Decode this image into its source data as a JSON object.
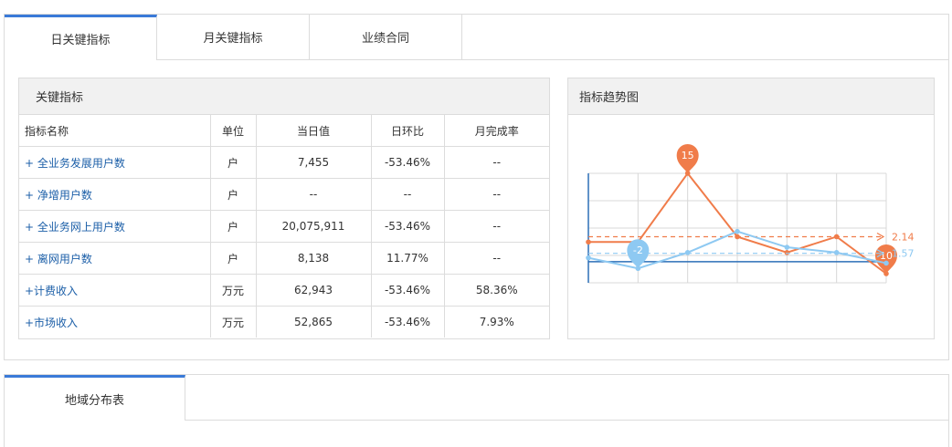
{
  "tabs": [
    {
      "label": "日关键指标",
      "active": true
    },
    {
      "label": "月关键指标",
      "active": false
    },
    {
      "label": "业绩合同",
      "active": false
    }
  ],
  "kpi": {
    "title": "关键指标",
    "headers": [
      "指标名称",
      "单位",
      "当日值",
      "日环比",
      "月完成率"
    ],
    "rows": [
      {
        "name": "+ 全业务发展用户数",
        "unit": "户",
        "value": "7,455",
        "dod": "-53.46%",
        "mtd": "--"
      },
      {
        "name": "+ 净增用户数",
        "unit": "户",
        "value": "--",
        "dod": "--",
        "mtd": "--"
      },
      {
        "name": "+ 全业务网上用户数",
        "unit": "户",
        "value": "20,075,911",
        "dod": "-53.46%",
        "mtd": "--"
      },
      {
        "name": "+ 离网用户数",
        "unit": "户",
        "value": "8,138",
        "dod": "11.77%",
        "mtd": "--"
      },
      {
        "name": "+计费收入",
        "unit": "万元",
        "value": "62,943",
        "dod": "-53.46%",
        "mtd": "58.36%"
      },
      {
        "name": "+市场收入",
        "unit": "万元",
        "value": "52,865",
        "dod": "-53.46%",
        "mtd": "7.93%"
      }
    ]
  },
  "trend": {
    "title": "指标趋势图"
  },
  "chart_data": {
    "type": "line",
    "title": "",
    "grid": true,
    "series": [
      {
        "color": "#f07c4a",
        "values": [
          2,
          2,
          15,
          3,
          0,
          3,
          -4
        ],
        "max_label": "15",
        "end_label": "10",
        "avg_label": "2.14"
      },
      {
        "color": "#8ec9f2",
        "values": [
          -1,
          -3,
          0,
          4,
          1,
          0,
          -2
        ],
        "min_label": "-2",
        "avg_label": "1.57"
      }
    ]
  },
  "region_tab": {
    "label": "地域分布表"
  }
}
